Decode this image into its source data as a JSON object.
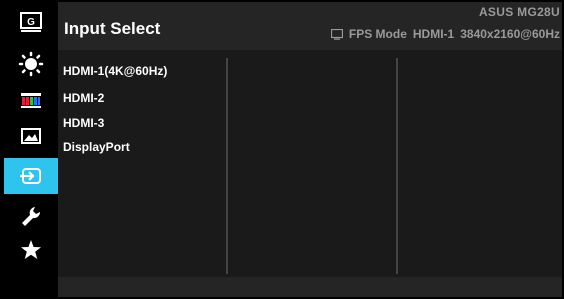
{
  "header": {
    "title": "Input Select",
    "model": "ASUS MG28U",
    "status": {
      "mode": "FPS Mode",
      "input": "HDMI-1",
      "resolution": "3840x2160@60Hz"
    }
  },
  "sidebar": {
    "items": [
      {
        "name": "gameplus",
        "icon": "g-icon"
      },
      {
        "name": "splendid",
        "icon": "brightness-icon"
      },
      {
        "name": "color",
        "icon": "color-bars-icon"
      },
      {
        "name": "image",
        "icon": "image-icon"
      },
      {
        "name": "input-select",
        "icon": "input-icon",
        "active": true
      },
      {
        "name": "system-setup",
        "icon": "wrench-icon"
      },
      {
        "name": "myfavorite",
        "icon": "star-icon"
      }
    ]
  },
  "options": [
    "HDMI-1(4K@60Hz)",
    "HDMI-2",
    "HDMI-3",
    "DisplayPort"
  ],
  "colors": {
    "accent": "#2ec4ee",
    "panel": "#1a1a1a",
    "header": "#252525"
  }
}
